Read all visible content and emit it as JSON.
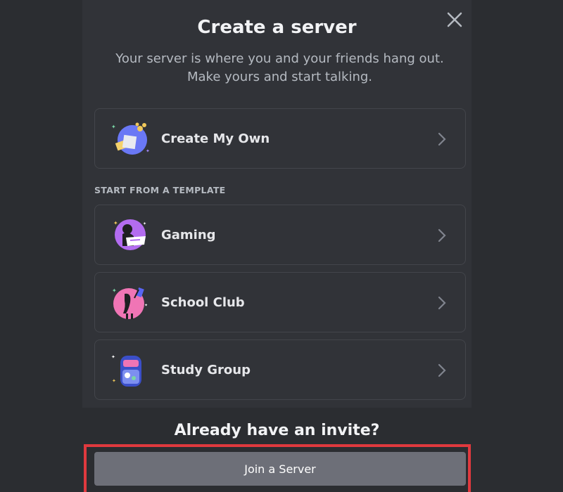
{
  "modal": {
    "title": "Create a server",
    "subtitle": "Your server is where you and your friends hang out. Make yours and start talking.",
    "close_icon": "close-icon"
  },
  "create_own": {
    "label": "Create My Own",
    "icon": "create-my-own-icon"
  },
  "templates": {
    "header": "START FROM A TEMPLATE",
    "items": [
      {
        "label": "Gaming",
        "icon": "gaming-icon"
      },
      {
        "label": "School Club",
        "icon": "school-club-icon"
      },
      {
        "label": "Study Group",
        "icon": "study-group-icon"
      }
    ]
  },
  "footer": {
    "title": "Already have an invite?",
    "join_label": "Join a Server",
    "highlight_color": "#e0393e"
  },
  "colors": {
    "background": "#2b2d31",
    "modal": "#313338",
    "button": "#6d6f78"
  }
}
